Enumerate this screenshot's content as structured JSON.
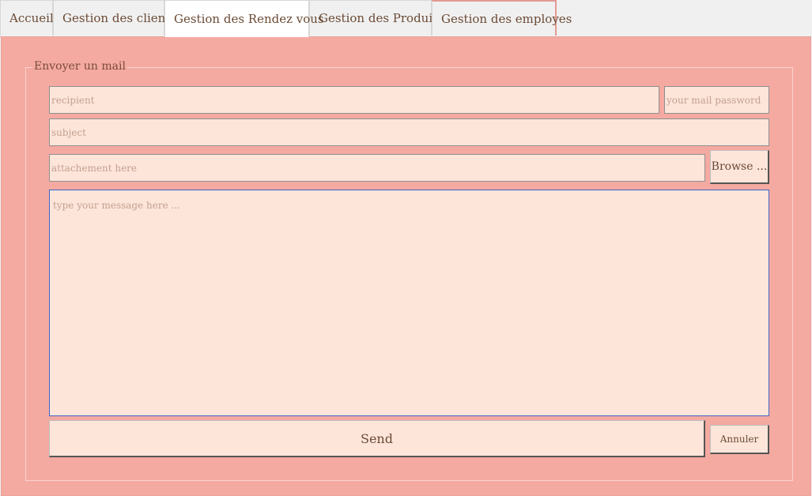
{
  "tabs": [
    {
      "label": "Accueil"
    },
    {
      "label": "Gestion des clients"
    },
    {
      "label": "Gestion des Rendez vous"
    },
    {
      "label": "Gestion des Produits"
    },
    {
      "label": "Gestion des employes"
    }
  ],
  "active_tab": "Gestion des Rendez vous",
  "mail_form": {
    "legend": "Envoyer un mail",
    "recipient": {
      "value": "",
      "placeholder": "recipient"
    },
    "password": {
      "value": "",
      "placeholder": "your mail password"
    },
    "subject": {
      "value": "",
      "placeholder": "subject"
    },
    "attachment": {
      "value": "",
      "placeholder": "attachement here"
    },
    "browse_label": "Browse ...",
    "message": {
      "value": "",
      "placeholder": "type your message here ..."
    },
    "send_label": "Send",
    "cancel_label": "Annuler"
  },
  "colors": {
    "panel_bg": "#f4aaa1",
    "field_bg": "#fde5da",
    "text": "#6b4a35",
    "focus_border": "#3d66c9"
  }
}
